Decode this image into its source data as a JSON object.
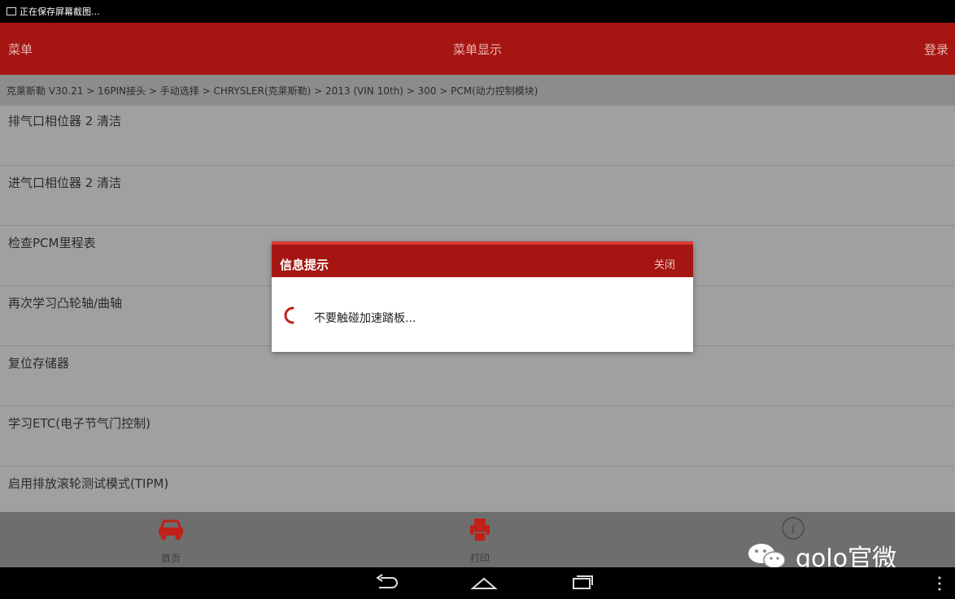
{
  "status_bar": {
    "notification": "正在保存屏幕截图..."
  },
  "title_bar": {
    "left": "菜单",
    "center": "菜单显示",
    "right": "登录"
  },
  "breadcrumb": "克莱斯勒 V30.21 > 16PIN接头 > 手动选择 > CHRYSLER(克莱斯勒) > 2013 (VIN 10th) > 300 > PCM(动力控制模块)",
  "menu_items": [
    "排气口相位器 2 清洁",
    "进气口相位器 2 清洁",
    "检查PCM里程表",
    "再次学习凸轮轴/曲轴",
    "复位存储器",
    "学习ETC(电子节气门控制)",
    "启用排放滚轮测试模式(TIPM)"
  ],
  "dialog": {
    "title": "信息提示",
    "close": "关闭",
    "message": "不要触碰加速踏板..."
  },
  "bottom_tabs": {
    "home": "首页",
    "print": "打印"
  },
  "watermark": "golo官微",
  "colors": {
    "brand_red": "#a51612",
    "list_bg": "#a0a0a0",
    "bottom_bg": "#6e6e6e"
  },
  "icons": {
    "home": "car-icon",
    "print": "printer-icon",
    "info": "info-icon",
    "nav": [
      "back-icon",
      "home-icon",
      "recents-icon",
      "overflow-menu-icon"
    ]
  }
}
